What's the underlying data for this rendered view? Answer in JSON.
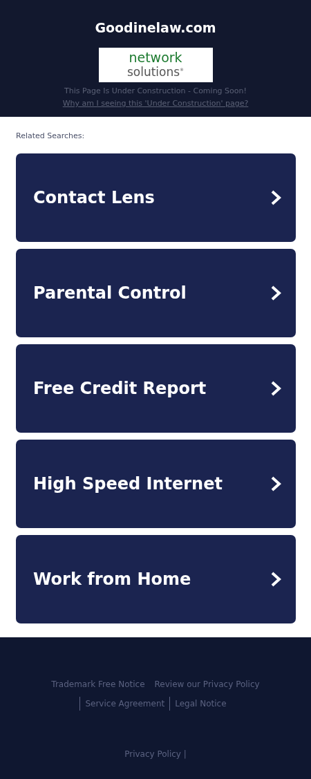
{
  "header": {
    "domain": "Goodinelaw.com",
    "logo": {
      "line_1": "network",
      "line_2": "solutions",
      "mark": "®"
    },
    "notice": "This Page Is Under Construction - Coming Soon!",
    "why_link": "Why am I seeing this 'Under Construction' page?"
  },
  "related_searches": {
    "title": "Related Searches:",
    "items": [
      {
        "label": "Contact Lens"
      },
      {
        "label": "Parental Control"
      },
      {
        "label": "Free Credit Report"
      },
      {
        "label": "High Speed Internet"
      },
      {
        "label": "Work from Home"
      }
    ]
  },
  "footer": {
    "links": [
      {
        "label": "Trademark Free Notice",
        "divider_before": false
      },
      {
        "label": "Review our Privacy Policy",
        "divider_before": false
      },
      {
        "label": "Service Agreement",
        "divider_before": true
      },
      {
        "label": "Legal Notice",
        "divider_before": true
      }
    ],
    "bottom_link": "Privacy Policy |"
  }
}
